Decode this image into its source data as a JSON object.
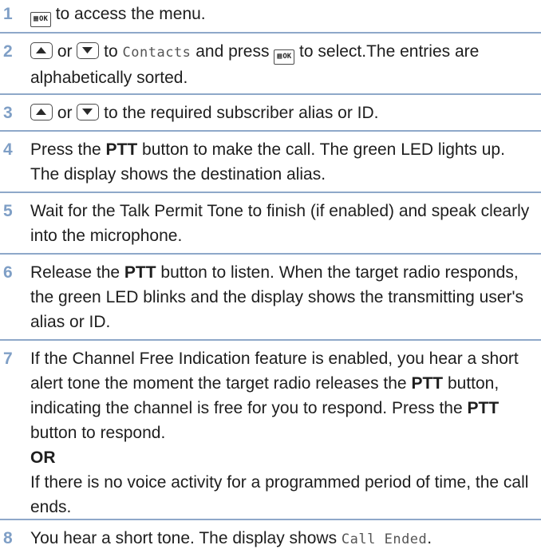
{
  "menu_ok_key": {
    "grid": "▦",
    "text": "OK"
  },
  "steps": [
    {
      "number": "1",
      "text_after_key": " to access the menu."
    },
    {
      "number": "2",
      "or": " or ",
      "to": " to ",
      "menu_item": "Contacts",
      "and_press": " and press ",
      "text_end": " to select.The entries are alphabetically sorted."
    },
    {
      "number": "3",
      "or": " or ",
      "text_end": " to the required subscriber alias or ID."
    },
    {
      "number": "4",
      "press": "Press the ",
      "ptt": "PTT",
      "text_end": " button to make the call. The green LED lights up. The display shows the destination alias."
    },
    {
      "number": "5",
      "text": "Wait for the Talk Permit Tone to finish (if enabled) and speak clearly into the microphone."
    },
    {
      "number": "6",
      "release": "Release the ",
      "ptt": "PTT",
      "text_end": " button to listen. When the target radio responds, the green LED blinks and the display shows the transmitting user's alias or ID."
    },
    {
      "number": "7",
      "para1_start": "If the Channel Free Indication feature is enabled, you hear a short alert tone the moment the target radio releases the ",
      "ptt1": "PTT",
      "para1_mid": " button, indicating the channel is free for you to respond. Press the ",
      "ptt2": "PTT",
      "para1_end": " button to respond.",
      "or_label": "OR",
      "para2": "If there is no voice activity for a programmed period of time, the call ends."
    },
    {
      "number": "8",
      "text": "You hear a short tone. The display shows ",
      "display_text": "Call Ended",
      "text_end": "."
    }
  ]
}
